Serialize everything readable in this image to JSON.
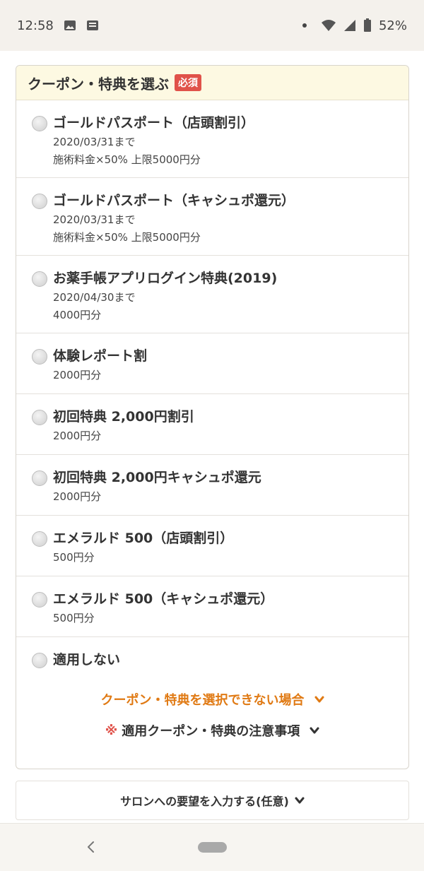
{
  "status_bar": {
    "time": "12:58",
    "battery": "52%"
  },
  "coupon_section": {
    "title": "クーポン・特典を選ぶ",
    "required_badge": "必須",
    "options": [
      {
        "title": "ゴールドパスポート（店頭割引）",
        "lines": [
          "2020/03/31まで",
          "施術料金×50% 上限5000円分"
        ]
      },
      {
        "title": "ゴールドパスポート（キャシュポ還元）",
        "lines": [
          "2020/03/31まで",
          "施術料金×50% 上限5000円分"
        ]
      },
      {
        "title": "お薬手帳アプリログイン特典(2019)",
        "lines": [
          "2020/04/30まで",
          "4000円分"
        ]
      },
      {
        "title": "体験レポート割",
        "lines": [
          "2000円分"
        ]
      },
      {
        "title": "初回特典 2,000円割引",
        "lines": [
          "2000円分"
        ]
      },
      {
        "title": "初回特典 2,000円キャシュポ還元",
        "lines": [
          "2000円分"
        ]
      },
      {
        "title": "エメラルド 500（店頭割引）",
        "lines": [
          "500円分"
        ]
      },
      {
        "title": "エメラルド 500（キャシュポ還元）",
        "lines": [
          "500円分"
        ]
      },
      {
        "title": "適用しない",
        "lines": []
      }
    ],
    "cannot_select_link": "クーポン・特典を選択できない場合",
    "notice_mark": "※",
    "notice_link": "適用クーポン・特典の注意事項"
  },
  "request": {
    "label": "サロンへの要望を入力する(任意)"
  },
  "colors": {
    "accent_orange": "#e07a14",
    "badge_red": "#e0524a",
    "header_bg": "#fdf9e2"
  }
}
